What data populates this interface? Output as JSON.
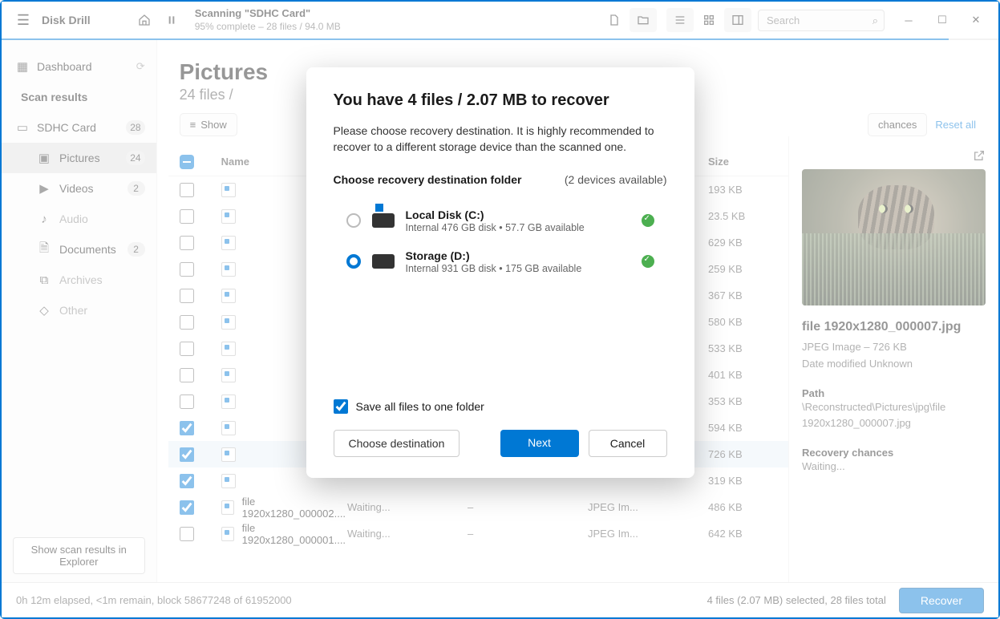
{
  "app": {
    "title": "Disk Drill"
  },
  "topbar": {
    "scan_title": "Scanning \"SDHC Card\"",
    "scan_subtitle": "95% complete – 28 files / 94.0 MB",
    "progress_percent": 95,
    "search_placeholder": "Search"
  },
  "sidebar": {
    "dashboard": "Dashboard",
    "scan_results_header": "Scan results",
    "explorer_button": "Show scan results in Explorer",
    "items": [
      {
        "icon": "drive",
        "label": "SDHC Card",
        "badge": "28"
      },
      {
        "icon": "picture",
        "label": "Pictures",
        "badge": "24",
        "active": true
      },
      {
        "icon": "video",
        "label": "Videos",
        "badge": "2"
      },
      {
        "icon": "audio",
        "label": "Audio",
        "faded": true
      },
      {
        "icon": "document",
        "label": "Documents",
        "badge": "2"
      },
      {
        "icon": "archive",
        "label": "Archives",
        "faded": true
      },
      {
        "icon": "other",
        "label": "Other",
        "faded": true
      }
    ]
  },
  "content": {
    "title": "Pictures",
    "subtitle": "24 files /",
    "show_label": "Show",
    "chances_label": "chances",
    "reset_label": "Reset all",
    "columns": {
      "name": "Name",
      "chances": "",
      "date": "",
      "type": "",
      "size": "Size"
    },
    "rows": [
      {
        "checked": false,
        "name": "",
        "chances": "",
        "date": "",
        "type": "",
        "size": "193 KB"
      },
      {
        "checked": false,
        "name": "",
        "chances": "",
        "date": "",
        "type": "",
        "size": "23.5 KB"
      },
      {
        "checked": false,
        "name": "",
        "chances": "",
        "date": "",
        "type": "",
        "size": "629 KB"
      },
      {
        "checked": false,
        "name": "",
        "chances": "",
        "date": "",
        "type": "",
        "size": "259 KB"
      },
      {
        "checked": false,
        "name": "",
        "chances": "",
        "date": "",
        "type": "",
        "size": "367 KB"
      },
      {
        "checked": false,
        "name": "",
        "chances": "",
        "date": "",
        "type": "",
        "size": "580 KB"
      },
      {
        "checked": false,
        "name": "",
        "chances": "",
        "date": "",
        "type": "",
        "size": "533 KB"
      },
      {
        "checked": false,
        "name": "",
        "chances": "",
        "date": "",
        "type": "",
        "size": "401 KB"
      },
      {
        "checked": false,
        "name": "",
        "chances": "",
        "date": "",
        "type": "",
        "size": "353 KB"
      },
      {
        "checked": true,
        "name": "",
        "chances": "",
        "date": "",
        "type": "",
        "size": "594 KB"
      },
      {
        "checked": true,
        "name": "",
        "chances": "",
        "date": "",
        "type": "",
        "size": "726 KB",
        "selected": true
      },
      {
        "checked": true,
        "name": "",
        "chances": "",
        "date": "",
        "type": "",
        "size": "319 KB"
      },
      {
        "checked": true,
        "name": "file 1920x1280_000002....",
        "chances": "Waiting...",
        "date": "–",
        "type": "JPEG Im...",
        "size": "486 KB"
      },
      {
        "checked": false,
        "name": "file 1920x1280_000001....",
        "chances": "Waiting...",
        "date": "–",
        "type": "JPEG Im...",
        "size": "642 KB"
      }
    ]
  },
  "preview": {
    "filename": "file 1920x1280_000007.jpg",
    "type_line": "JPEG Image – 726 KB",
    "date_line": "Date modified Unknown",
    "path_header": "Path",
    "path_value": "\\Reconstructed\\Pictures\\jpg\\file 1920x1280_000007.jpg",
    "chances_header": "Recovery chances",
    "chances_value": "Waiting..."
  },
  "footer": {
    "elapsed": "0h 12m elapsed, <1m remain, block 58677248 of 61952000",
    "selection": "4 files (2.07 MB) selected, 28 files total",
    "recover_label": "Recover"
  },
  "dialog": {
    "title": "You have 4 files / 2.07 MB to recover",
    "description": "Please choose recovery destination. It is highly recommended to recover to a different storage device than the scanned one.",
    "choose_label": "Choose recovery destination folder",
    "devices_label": "(2 devices available)",
    "destinations": [
      {
        "name": "Local Disk (C:)",
        "detail": "Internal 476 GB disk • 57.7 GB available",
        "selected": false,
        "win": true
      },
      {
        "name": "Storage (D:)",
        "detail": "Internal 931 GB disk • 175 GB available",
        "selected": true,
        "win": false
      }
    ],
    "save_one_folder": "Save all files to one folder",
    "choose_dest_btn": "Choose destination",
    "next_btn": "Next",
    "cancel_btn": "Cancel"
  }
}
